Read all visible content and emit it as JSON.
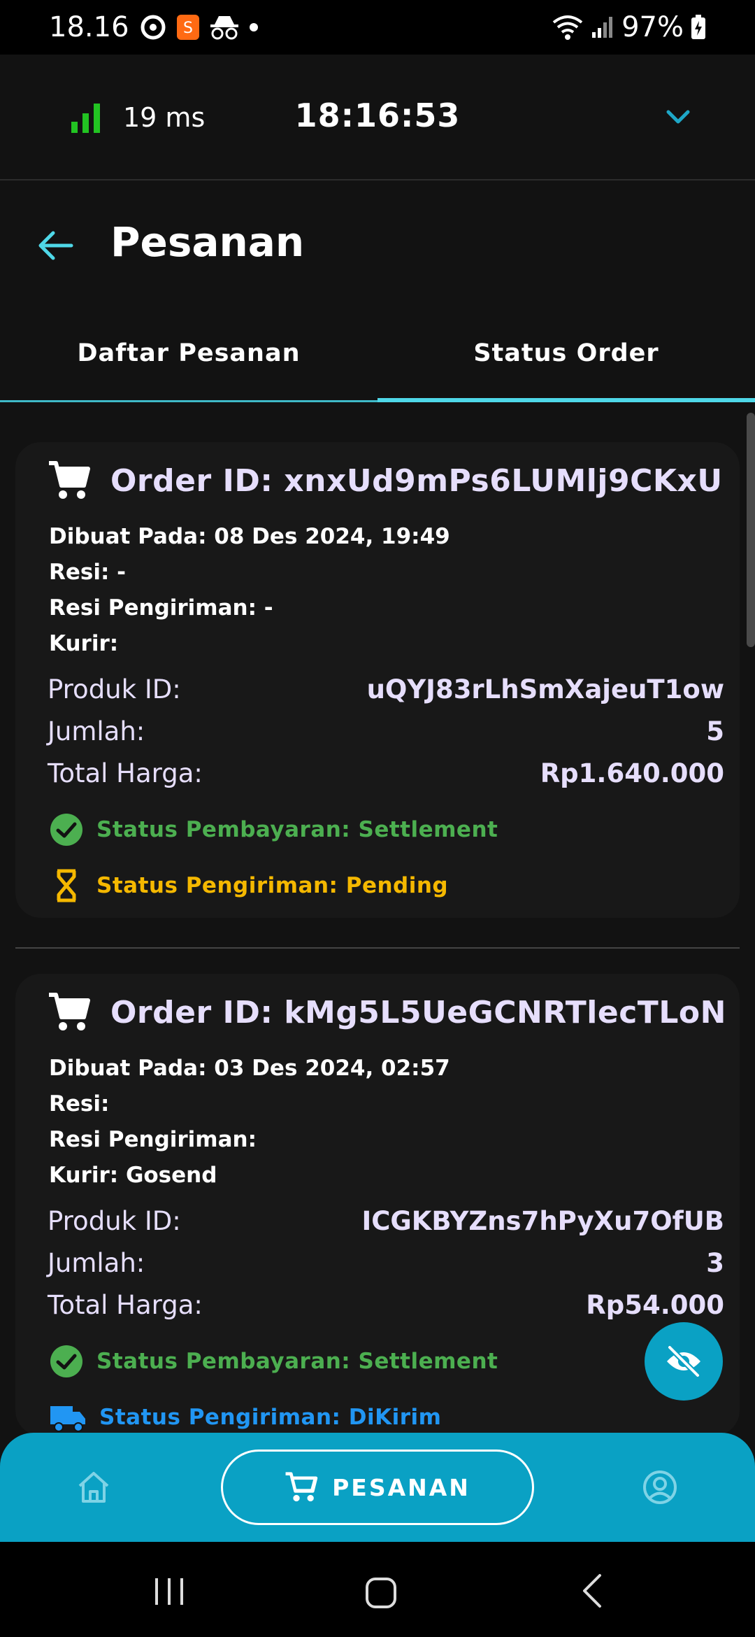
{
  "status_bar": {
    "time": "18.16",
    "battery": "97%"
  },
  "topbar": {
    "ping": "19 ms",
    "clock": "18:16:53"
  },
  "header": {
    "title": "Pesanan"
  },
  "tabs": [
    {
      "label": "Daftar Pesanan",
      "active": false
    },
    {
      "label": "Status Order",
      "active": true
    }
  ],
  "orders": [
    {
      "order_id": "Order ID: xnxUd9mPs6LUMlj9CKxU",
      "created": "Dibuat Pada: 08 Des 2024, 19:49",
      "resi": "Resi: -",
      "resi_pengiriman": "Resi Pengiriman: -",
      "kurir": "Kurir:",
      "produk_label": "Produk ID:",
      "produk_value": "uQYJ83rLhSmXajeuT1ow",
      "jumlah_label": "Jumlah:",
      "jumlah_value": "5",
      "total_label": "Total Harga:",
      "total_value": "Rp1.640.000",
      "payment_status": "Status Pembayaran: Settlement",
      "shipping_status": "Status Pengiriman: Pending"
    },
    {
      "order_id": "Order ID: kMg5L5UeGCNRTlecTLoN",
      "created": "Dibuat Pada: 03 Des 2024, 02:57",
      "resi": "Resi:",
      "resi_pengiriman": "Resi Pengiriman:",
      "kurir": "Kurir: Gosend",
      "produk_label": "Produk ID:",
      "produk_value": "ICGKBYZns7hPyXu7OfUB",
      "jumlah_label": "Jumlah:",
      "jumlah_value": "3",
      "total_label": "Total Harga:",
      "total_value": "Rp54.000",
      "payment_status": "Status Pembayaran: Settlement",
      "shipping_status": "Status Pengiriman: DiKirim"
    }
  ],
  "bottom_nav": {
    "active_label": "PESANAN"
  },
  "colors": {
    "accent": "#0aa1c4",
    "tab_indicator": "#4fd8e8",
    "order_id_text": "#e6defc",
    "status_green": "#4caf50",
    "status_amber": "#f5b800",
    "status_blue": "#2196f3"
  },
  "icons": {
    "signal": "signal-bars-icon",
    "dropdown": "chevron-down-icon",
    "back": "arrow-left-icon",
    "cart": "cart-icon",
    "check": "check-circle-icon",
    "hourglass": "hourglass-icon",
    "truck": "truck-icon",
    "hide": "eye-off-icon",
    "home": "home-icon",
    "profile": "profile-icon"
  }
}
